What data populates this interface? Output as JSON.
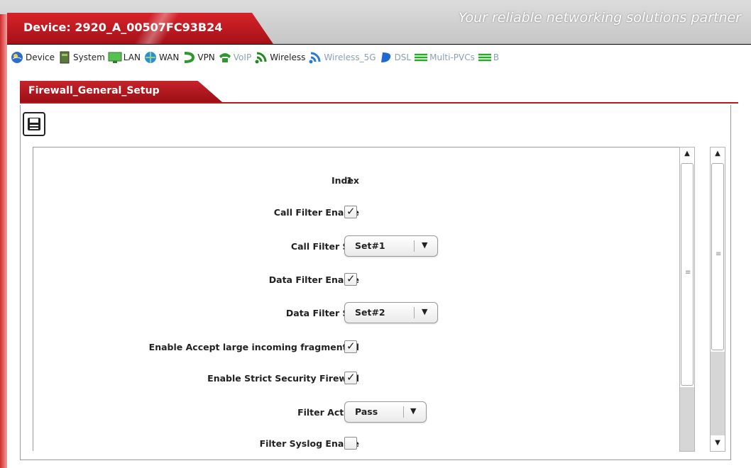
{
  "header": {
    "device_title": "Device: 2920_A_00507FC93B24",
    "slogan": "Your reliable networking solutions partner"
  },
  "menu": {
    "items": [
      {
        "label": "Device",
        "icon": "globe-icon"
      },
      {
        "label": "System",
        "icon": "document-icon"
      },
      {
        "label": "LAN",
        "icon": "monitor-icon"
      },
      {
        "label": "WAN",
        "icon": "globe-network-icon"
      },
      {
        "label": "VPN",
        "icon": "vpn-icon"
      },
      {
        "label": "VoIP",
        "icon": "phone-icon"
      },
      {
        "label": "Wireless",
        "icon": "wireless-icon"
      },
      {
        "label": "Wireless_5G",
        "icon": "wireless-5g-icon"
      },
      {
        "label": "DSL",
        "icon": "dsl-icon"
      },
      {
        "label": "Multi-PVCs",
        "icon": "multi-pvc-icon"
      },
      {
        "label": "B",
        "icon": "bridge-icon"
      }
    ]
  },
  "tab": {
    "title": "Firewall_General_Setup"
  },
  "form": {
    "index_label": "Index",
    "index_value": "1",
    "call_filter_enable_label": "Call Filter Enable",
    "call_filter_enable_checked": true,
    "call_filter_set_label": "Call Filter Set",
    "call_filter_set_value": "Set#1",
    "data_filter_enable_label": "Data Filter Enable",
    "data_filter_enable_checked": true,
    "data_filter_set_label": "Data Filter Set",
    "data_filter_set_value": "Set#2",
    "large_fragment_label": "Enable Accept large incoming fragmented",
    "large_fragment_checked": true,
    "strict_firewall_label": "Enable Strict Security Firewall",
    "strict_firewall_checked": true,
    "filter_action_label": "Filter Action",
    "filter_action_value": "Pass",
    "syslog_label": "Filter Syslog Enable",
    "syslog_checked": false
  },
  "glyphs": {
    "check": "✓",
    "dropdown_arrow": "▼",
    "scroll_up": "▲",
    "scroll_down": "▼",
    "grip": "≡"
  },
  "colors": {
    "brand_red": "#c8232a",
    "header_gray": "#c6c6c6",
    "wireless_green": "#2a9a2a"
  }
}
